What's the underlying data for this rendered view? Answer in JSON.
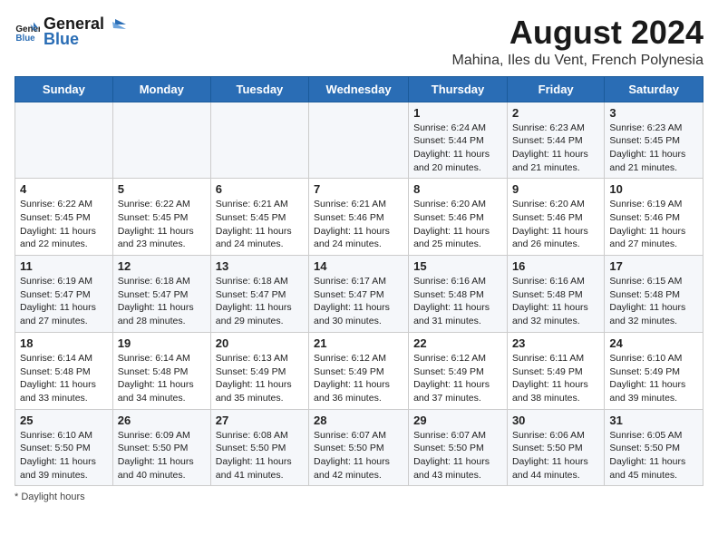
{
  "logo": {
    "line1": "General",
    "line2": "Blue"
  },
  "title": "August 2024",
  "subtitle": "Mahina, Iles du Vent, French Polynesia",
  "days_of_week": [
    "Sunday",
    "Monday",
    "Tuesday",
    "Wednesday",
    "Thursday",
    "Friday",
    "Saturday"
  ],
  "weeks": [
    [
      {
        "day": "",
        "info": ""
      },
      {
        "day": "",
        "info": ""
      },
      {
        "day": "",
        "info": ""
      },
      {
        "day": "",
        "info": ""
      },
      {
        "day": "1",
        "info": "Sunrise: 6:24 AM\nSunset: 5:44 PM\nDaylight: 11 hours and 20 minutes."
      },
      {
        "day": "2",
        "info": "Sunrise: 6:23 AM\nSunset: 5:44 PM\nDaylight: 11 hours and 21 minutes."
      },
      {
        "day": "3",
        "info": "Sunrise: 6:23 AM\nSunset: 5:45 PM\nDaylight: 11 hours and 21 minutes."
      }
    ],
    [
      {
        "day": "4",
        "info": "Sunrise: 6:22 AM\nSunset: 5:45 PM\nDaylight: 11 hours and 22 minutes."
      },
      {
        "day": "5",
        "info": "Sunrise: 6:22 AM\nSunset: 5:45 PM\nDaylight: 11 hours and 23 minutes."
      },
      {
        "day": "6",
        "info": "Sunrise: 6:21 AM\nSunset: 5:45 PM\nDaylight: 11 hours and 24 minutes."
      },
      {
        "day": "7",
        "info": "Sunrise: 6:21 AM\nSunset: 5:46 PM\nDaylight: 11 hours and 24 minutes."
      },
      {
        "day": "8",
        "info": "Sunrise: 6:20 AM\nSunset: 5:46 PM\nDaylight: 11 hours and 25 minutes."
      },
      {
        "day": "9",
        "info": "Sunrise: 6:20 AM\nSunset: 5:46 PM\nDaylight: 11 hours and 26 minutes."
      },
      {
        "day": "10",
        "info": "Sunrise: 6:19 AM\nSunset: 5:46 PM\nDaylight: 11 hours and 27 minutes."
      }
    ],
    [
      {
        "day": "11",
        "info": "Sunrise: 6:19 AM\nSunset: 5:47 PM\nDaylight: 11 hours and 27 minutes."
      },
      {
        "day": "12",
        "info": "Sunrise: 6:18 AM\nSunset: 5:47 PM\nDaylight: 11 hours and 28 minutes."
      },
      {
        "day": "13",
        "info": "Sunrise: 6:18 AM\nSunset: 5:47 PM\nDaylight: 11 hours and 29 minutes."
      },
      {
        "day": "14",
        "info": "Sunrise: 6:17 AM\nSunset: 5:47 PM\nDaylight: 11 hours and 30 minutes."
      },
      {
        "day": "15",
        "info": "Sunrise: 6:16 AM\nSunset: 5:48 PM\nDaylight: 11 hours and 31 minutes."
      },
      {
        "day": "16",
        "info": "Sunrise: 6:16 AM\nSunset: 5:48 PM\nDaylight: 11 hours and 32 minutes."
      },
      {
        "day": "17",
        "info": "Sunrise: 6:15 AM\nSunset: 5:48 PM\nDaylight: 11 hours and 32 minutes."
      }
    ],
    [
      {
        "day": "18",
        "info": "Sunrise: 6:14 AM\nSunset: 5:48 PM\nDaylight: 11 hours and 33 minutes."
      },
      {
        "day": "19",
        "info": "Sunrise: 6:14 AM\nSunset: 5:48 PM\nDaylight: 11 hours and 34 minutes."
      },
      {
        "day": "20",
        "info": "Sunrise: 6:13 AM\nSunset: 5:49 PM\nDaylight: 11 hours and 35 minutes."
      },
      {
        "day": "21",
        "info": "Sunrise: 6:12 AM\nSunset: 5:49 PM\nDaylight: 11 hours and 36 minutes."
      },
      {
        "day": "22",
        "info": "Sunrise: 6:12 AM\nSunset: 5:49 PM\nDaylight: 11 hours and 37 minutes."
      },
      {
        "day": "23",
        "info": "Sunrise: 6:11 AM\nSunset: 5:49 PM\nDaylight: 11 hours and 38 minutes."
      },
      {
        "day": "24",
        "info": "Sunrise: 6:10 AM\nSunset: 5:49 PM\nDaylight: 11 hours and 39 minutes."
      }
    ],
    [
      {
        "day": "25",
        "info": "Sunrise: 6:10 AM\nSunset: 5:50 PM\nDaylight: 11 hours and 39 minutes."
      },
      {
        "day": "26",
        "info": "Sunrise: 6:09 AM\nSunset: 5:50 PM\nDaylight: 11 hours and 40 minutes."
      },
      {
        "day": "27",
        "info": "Sunrise: 6:08 AM\nSunset: 5:50 PM\nDaylight: 11 hours and 41 minutes."
      },
      {
        "day": "28",
        "info": "Sunrise: 6:07 AM\nSunset: 5:50 PM\nDaylight: 11 hours and 42 minutes."
      },
      {
        "day": "29",
        "info": "Sunrise: 6:07 AM\nSunset: 5:50 PM\nDaylight: 11 hours and 43 minutes."
      },
      {
        "day": "30",
        "info": "Sunrise: 6:06 AM\nSunset: 5:50 PM\nDaylight: 11 hours and 44 minutes."
      },
      {
        "day": "31",
        "info": "Sunrise: 6:05 AM\nSunset: 5:50 PM\nDaylight: 11 hours and 45 minutes."
      }
    ]
  ],
  "footer": {
    "daylight_label": "Daylight hours"
  }
}
